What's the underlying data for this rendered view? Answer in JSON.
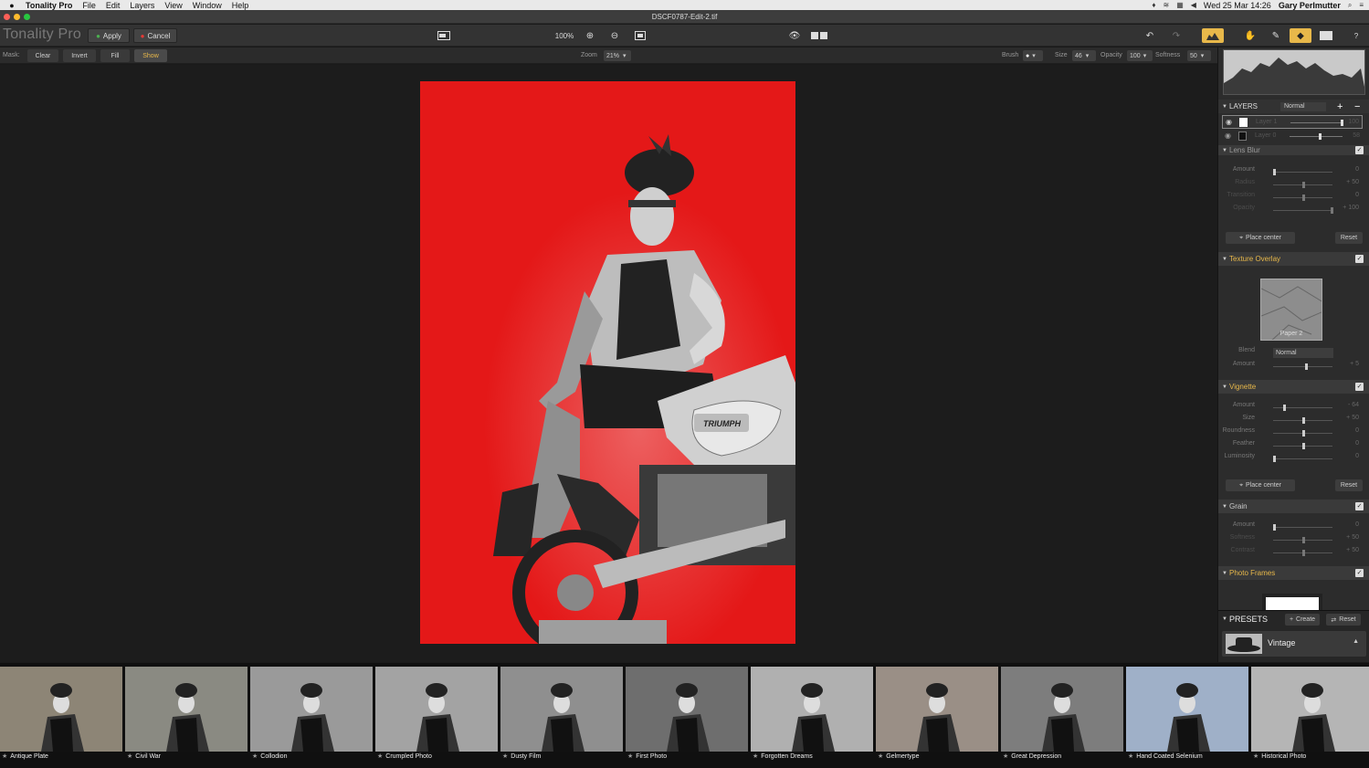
{
  "menubar": {
    "apple": "",
    "app": "Tonality Pro",
    "items": [
      "File",
      "Edit",
      "Layers",
      "View",
      "Window",
      "Help"
    ],
    "datetime": "Wed 25 Mar 14:26",
    "user": "Gary Perlmutter"
  },
  "window": {
    "title": "DSCF0787-Edit-2.tif"
  },
  "toolbar": {
    "brand": "Tonality Pro",
    "apply": "Apply",
    "cancel": "Cancel",
    "zoom_display": "100%"
  },
  "maskbar": {
    "mask_label": "Mask:",
    "clear": "Clear",
    "invert": "Invert",
    "fill": "Fill",
    "show": "Show",
    "zoom_label": "Zoom",
    "zoom_value": "21%",
    "brush_label": "Brush",
    "size_label": "Size",
    "size_value": "46",
    "opacity_label": "Opacity",
    "opacity_value": "100",
    "softness_label": "Softness",
    "softness_value": "50"
  },
  "photo": {
    "badge": "TRIUMPH"
  },
  "layers": {
    "header": "LAYERS",
    "blend": "Normal",
    "items": [
      {
        "name": "Layer 1",
        "value": "100",
        "level": 1.0
      },
      {
        "name": "Layer 0",
        "value": "58",
        "level": 0.58
      }
    ]
  },
  "lens_blur": {
    "title": "Lens Blur",
    "rows": [
      {
        "label": "Amount",
        "value": "0",
        "level": 0
      },
      {
        "label": "Radius",
        "value": "+ 50",
        "level": 0.5
      },
      {
        "label": "Transition",
        "value": "0",
        "level": 0.5
      },
      {
        "label": "Opacity",
        "value": "+ 100",
        "level": 1.0
      }
    ],
    "place_center": "Place center",
    "reset": "Reset"
  },
  "texture": {
    "title": "Texture Overlay",
    "texture_name": "Paper 2",
    "blend_label": "Blend",
    "blend_value": "Normal",
    "amount_label": "Amount",
    "amount_value": "+ 5",
    "amount_level": 0.55
  },
  "vignette": {
    "title": "Vignette",
    "rows": [
      {
        "label": "Amount",
        "value": "- 64",
        "level": 0.18
      },
      {
        "label": "Size",
        "value": "+ 50",
        "level": 0.5
      },
      {
        "label": "Roundness",
        "value": "0",
        "level": 0.5
      },
      {
        "label": "Feather",
        "value": "0",
        "level": 0.5
      },
      {
        "label": "Luminosity",
        "value": "0",
        "level": 0
      }
    ],
    "place_center": "Place center",
    "reset": "Reset"
  },
  "grain": {
    "title": "Grain",
    "rows": [
      {
        "label": "Amount",
        "value": "0",
        "level": 0
      },
      {
        "label": "Softness",
        "value": "+ 50",
        "level": 0.5
      },
      {
        "label": "Contrast",
        "value": "+ 50",
        "level": 0.5
      }
    ]
  },
  "photo_frames": {
    "title": "Photo Frames"
  },
  "presets": {
    "header": "PRESETS",
    "create": "Create",
    "reset": "Reset",
    "category": "Vintage"
  },
  "filmstrip": [
    "Antique Plate",
    "Civil War",
    "Collodion",
    "Crumpled Photo",
    "Dusty Film",
    "First Photo",
    "Forgotten Dreams",
    "Gelmertype",
    "Great Depression",
    "Hand Coated Selenium",
    "Historical Photo"
  ],
  "colors": {
    "accent": "#e8b84a",
    "mask_red": "#e41818"
  }
}
